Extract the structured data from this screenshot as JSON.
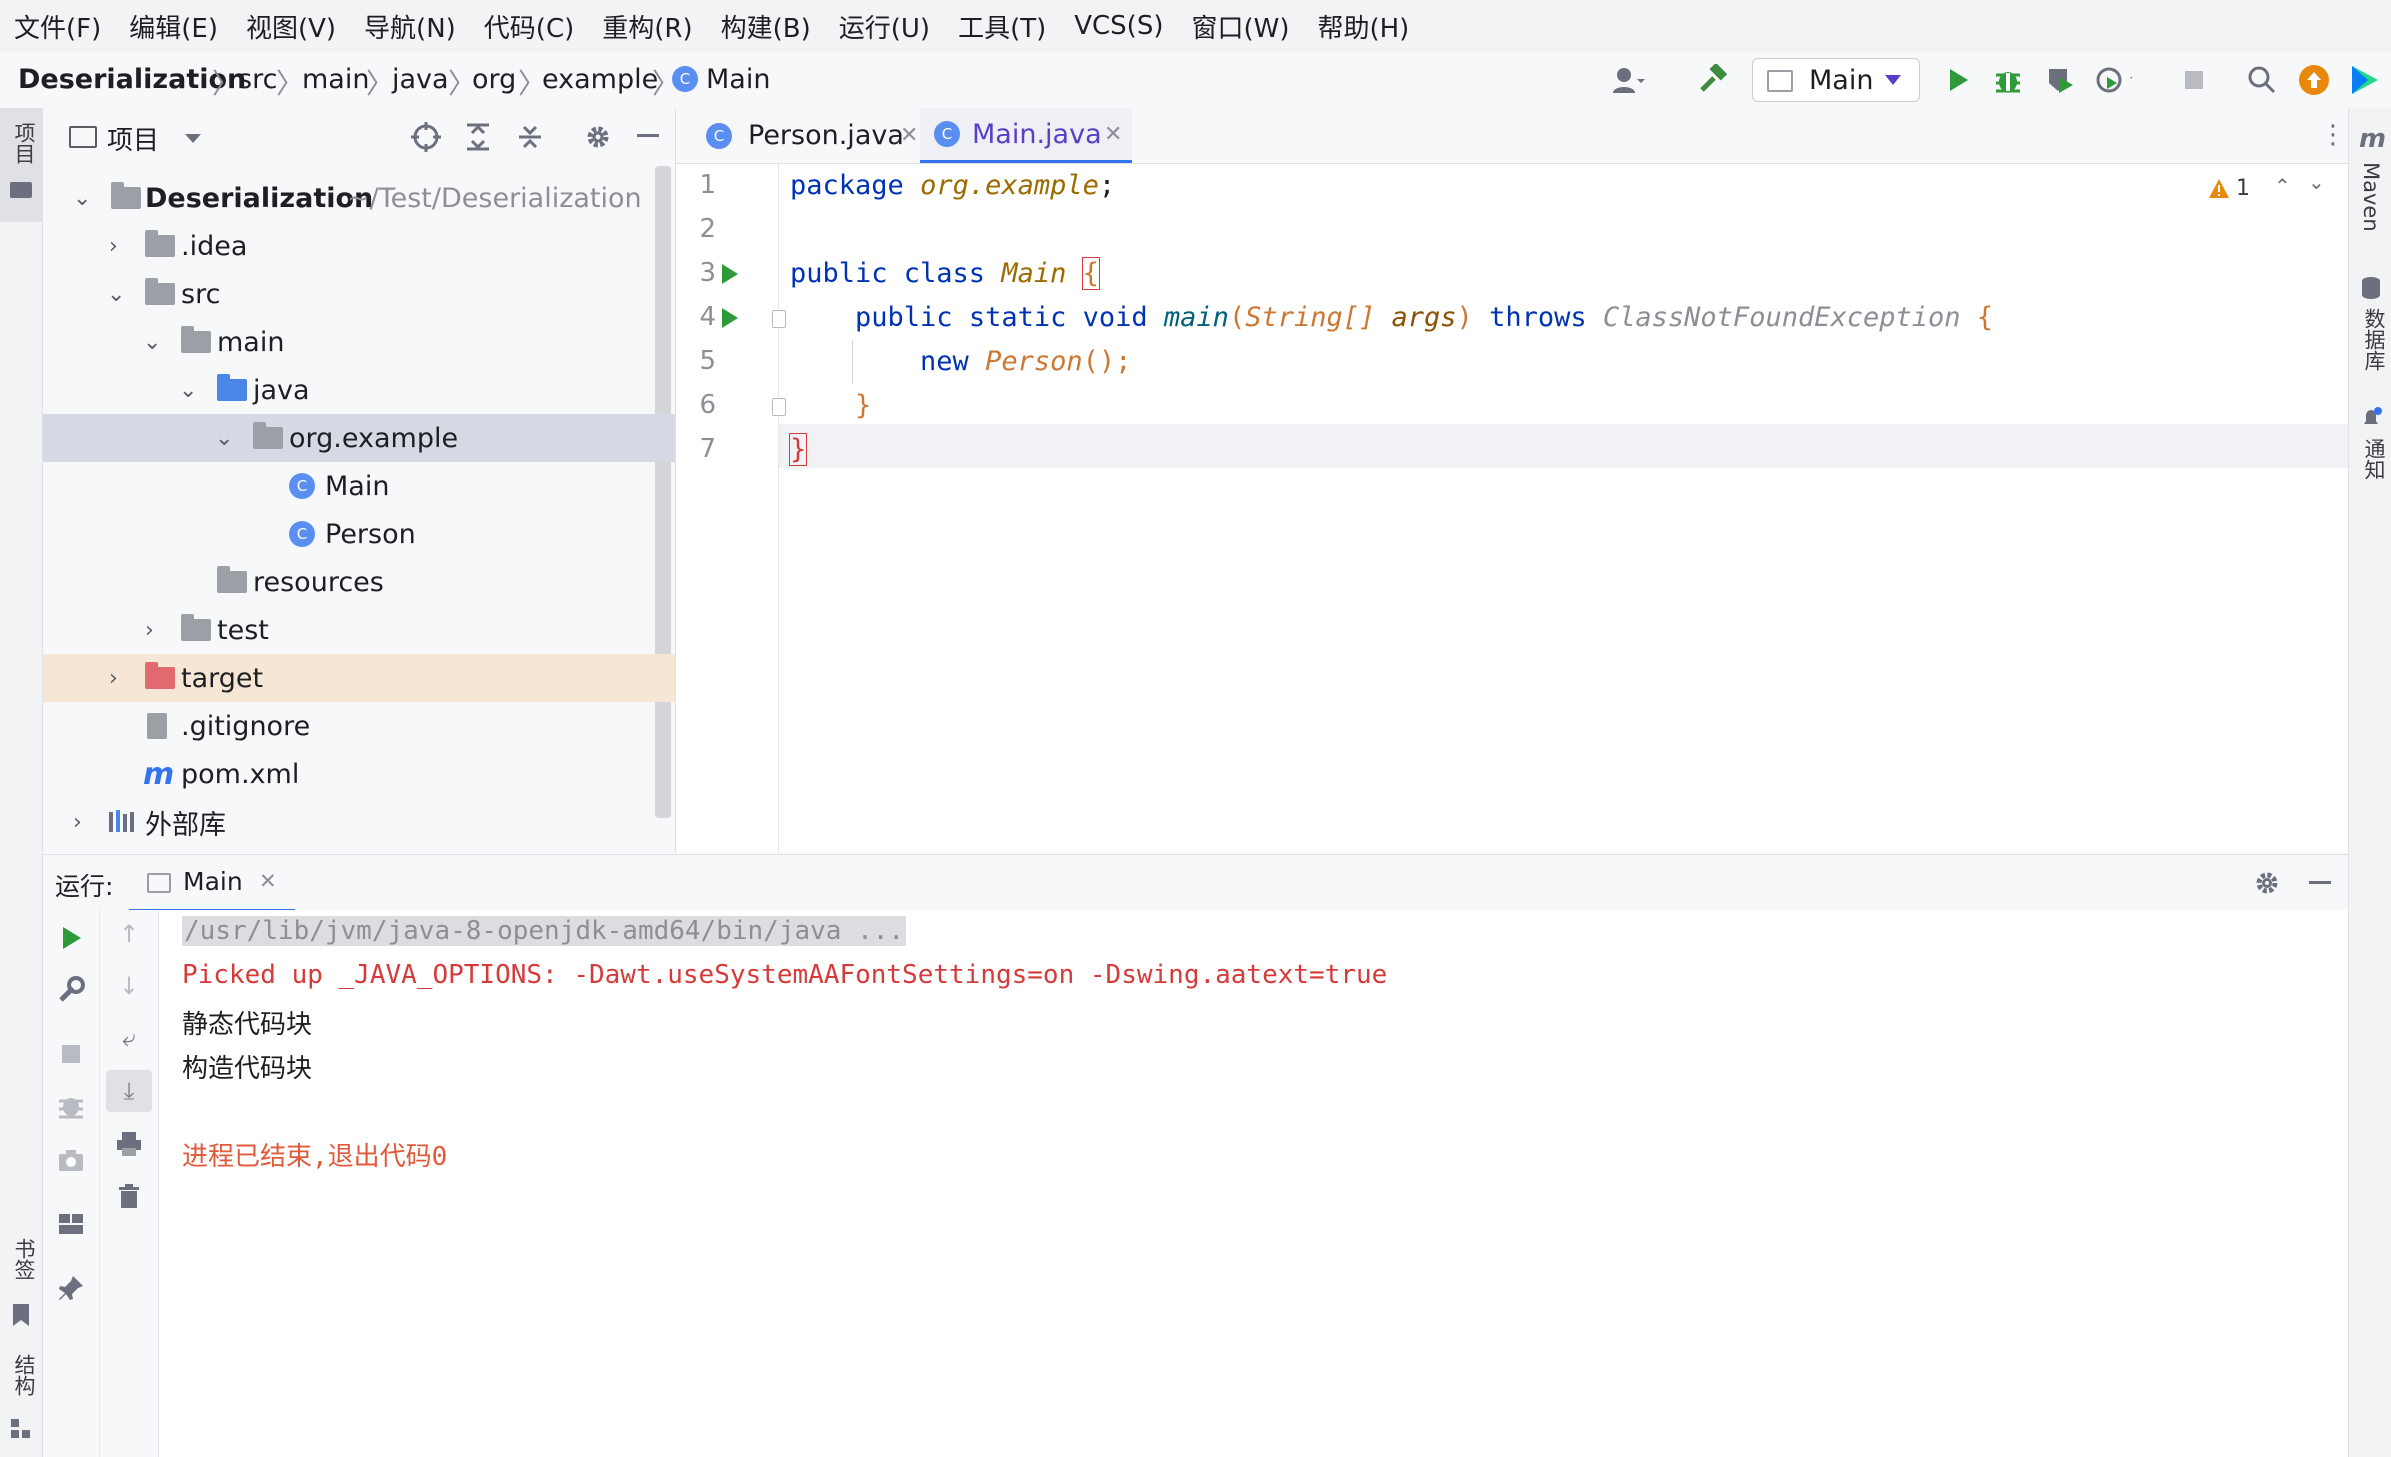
{
  "menu": [
    "文件(F)",
    "编辑(E)",
    "视图(V)",
    "导航(N)",
    "代码(C)",
    "重构(R)",
    "构建(B)",
    "运行(U)",
    "工具(T)",
    "VCS(S)",
    "窗口(W)",
    "帮助(H)"
  ],
  "breadcrumb": [
    "Deserialization",
    "src",
    "main",
    "java",
    "org",
    "example",
    "Main"
  ],
  "run_config": "Main",
  "left_stripe": {
    "project": "项目",
    "bookmarks": "书签",
    "structure": "结构"
  },
  "right_stripe": {
    "maven": "Maven",
    "database": "数据库",
    "notifications": "通知"
  },
  "project_panel": {
    "title": "项目",
    "tree": [
      {
        "label": "Deserialization",
        "hint": "~/Test/Deserialization",
        "bold": true
      },
      {
        "label": ".idea"
      },
      {
        "label": "src"
      },
      {
        "label": "main"
      },
      {
        "label": "java"
      },
      {
        "label": "org.example"
      },
      {
        "label": "Main"
      },
      {
        "label": "Person"
      },
      {
        "label": "resources"
      },
      {
        "label": "test"
      },
      {
        "label": "target"
      },
      {
        "label": ".gitignore"
      },
      {
        "label": "pom.xml"
      },
      {
        "label": "外部库"
      }
    ]
  },
  "tabs": [
    {
      "label": "Person.java",
      "active": false
    },
    {
      "label": "Main.java",
      "active": true
    }
  ],
  "warnings_count": "1",
  "code": {
    "line_numbers": [
      "1",
      "2",
      "3",
      "4",
      "5",
      "6",
      "7"
    ],
    "l1": {
      "kw": "package",
      "pkg": "org.example",
      "end": ";"
    },
    "l3": {
      "kw": "public class",
      "name": "Main",
      "brace": "{"
    },
    "l4": {
      "kw": "public static void",
      "fn": "main",
      "p1": "(",
      "type": "String[]",
      "arg": "args",
      "p2": ")",
      "throws": "throws",
      "exc": "ClassNotFoundException",
      "brace": "{"
    },
    "l5": {
      "kw": "new",
      "cls": "Person",
      "end": "();"
    },
    "l6": {
      "brace": "}"
    },
    "l7": {
      "brace": "}"
    }
  },
  "run_panel": {
    "label": "运行:",
    "tab": "Main",
    "output": {
      "cmd": "/usr/lib/jvm/java-8-openjdk-amd64/bin/java ...",
      "options": "Picked up _JAVA_OPTIONS: -Dawt.useSystemAAFontSettings=on -Dswing.aatext=true",
      "line1": "静态代码块",
      "line2": "构造代码块",
      "exit": "进程已结束,退出代码0"
    }
  },
  "colors": {
    "accent": "#3574f0",
    "run_green": "#2e9a3a",
    "error_red": "#d63b3b",
    "orange": "#cc7832"
  }
}
